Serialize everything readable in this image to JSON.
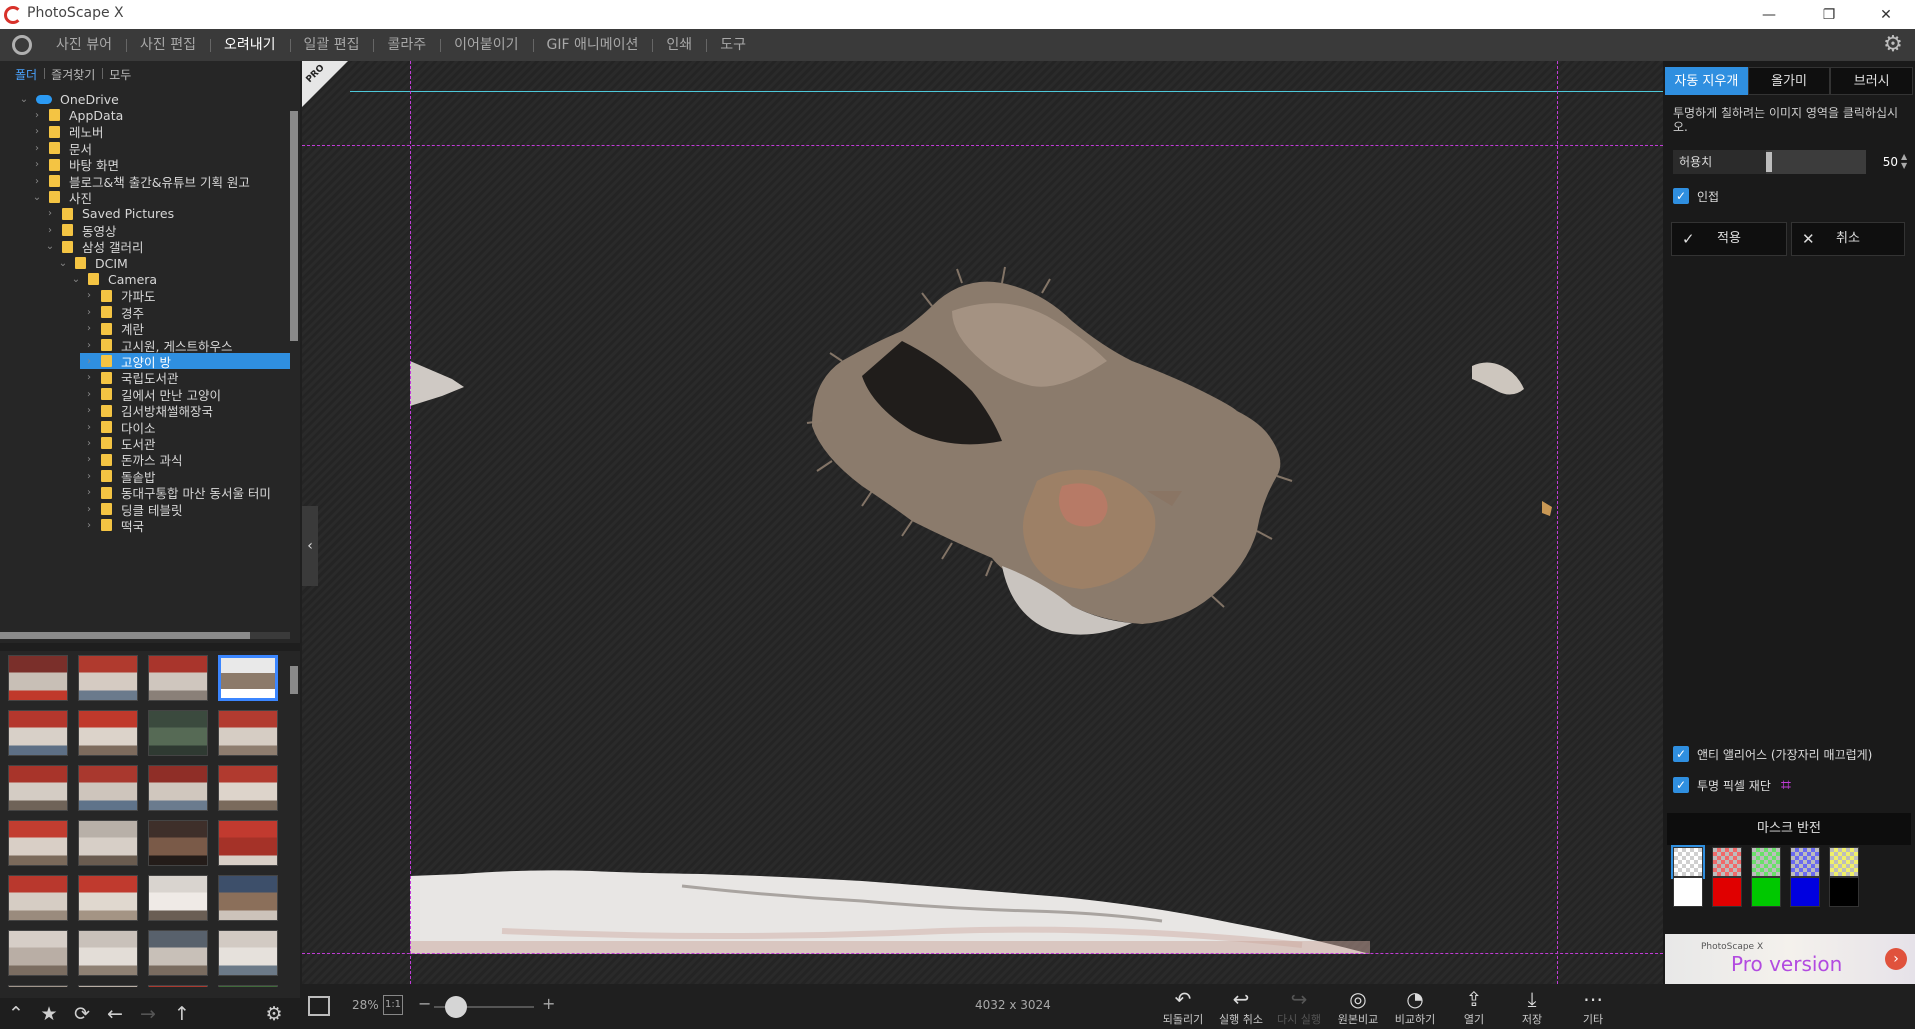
{
  "window": {
    "title": "PhotoScape X",
    "controls": [
      "—",
      "❐",
      "✕"
    ]
  },
  "menu": {
    "items": [
      {
        "label": "사진 뷰어"
      },
      {
        "label": "사진 편집"
      },
      {
        "label": "오려내기",
        "active": true
      },
      {
        "label": "일괄 편집"
      },
      {
        "label": "콜라주"
      },
      {
        "label": "이어붙이기"
      },
      {
        "label": "GIF 애니메이션"
      },
      {
        "label": "인쇄"
      },
      {
        "label": "도구"
      }
    ]
  },
  "left_panel": {
    "tabs": [
      {
        "label": "폴더",
        "active": true
      },
      {
        "label": "즐겨찾기"
      },
      {
        "label": "모두"
      }
    ],
    "tree": [
      {
        "label": "OneDrive",
        "depth": 1,
        "expanded": true,
        "icon": "cloud-icon"
      },
      {
        "label": "AppData",
        "depth": 2
      },
      {
        "label": "레노버",
        "depth": 2
      },
      {
        "label": "문서",
        "depth": 2
      },
      {
        "label": "바탕 화면",
        "depth": 2
      },
      {
        "label": "블로그&책 출간&유튜브 기획 원고",
        "depth": 2
      },
      {
        "label": "사진",
        "depth": 2,
        "expanded": true
      },
      {
        "label": "Saved Pictures",
        "depth": 3
      },
      {
        "label": "동영상",
        "depth": 3
      },
      {
        "label": "삼성 갤러리",
        "depth": 3,
        "expanded": true
      },
      {
        "label": "DCIM",
        "depth": 4,
        "expanded": true
      },
      {
        "label": "Camera",
        "depth": 5,
        "expanded": true
      },
      {
        "label": "가파도",
        "depth": 6
      },
      {
        "label": "경주",
        "depth": 6
      },
      {
        "label": "계란",
        "depth": 6
      },
      {
        "label": "고시원, 게스트하우스",
        "depth": 6
      },
      {
        "label": "고양이 방",
        "depth": 6,
        "selected": true
      },
      {
        "label": "국립도서관",
        "depth": 6
      },
      {
        "label": "길에서 만난 고양이",
        "depth": 6
      },
      {
        "label": "김서방채썰해장국",
        "depth": 6
      },
      {
        "label": "다이소",
        "depth": 6
      },
      {
        "label": "도서관",
        "depth": 6
      },
      {
        "label": "돈까스 과식",
        "depth": 6
      },
      {
        "label": "돌솥밥",
        "depth": 6
      },
      {
        "label": "동대구통합 마산 동서울 터미",
        "depth": 6
      },
      {
        "label": "딩클 테블릿",
        "depth": 6
      },
      {
        "label": "떡국",
        "depth": 6
      }
    ],
    "thumbnails": [
      {
        "colors": [
          "#7a2f2a",
          "#c8bfb6",
          "#c0392b"
        ]
      },
      {
        "colors": [
          "#b03a2e",
          "#d5cbc2",
          "#6a7a8c"
        ]
      },
      {
        "colors": [
          "#a9352c",
          "#cfc6be",
          "#8a8078"
        ]
      },
      {
        "colors": [
          "#e9e9e9",
          "#8c7a6a",
          "#ffffff"
        ],
        "selected": true
      },
      {
        "colors": [
          "#b4372d",
          "#d8d0c8",
          "#5d6f85"
        ]
      },
      {
        "colors": [
          "#c0392b",
          "#dcd3ca",
          "#7d6b5d"
        ]
      },
      {
        "colors": [
          "#3b4a3e",
          "#566a55",
          "#2f3a32"
        ]
      },
      {
        "colors": [
          "#b23b30",
          "#d6cdc4",
          "#8e7d6f"
        ]
      },
      {
        "colors": [
          "#a8342a",
          "#d4ccc4",
          "#6f6358"
        ]
      },
      {
        "colors": [
          "#a9382e",
          "#cec5bc",
          "#5f738a"
        ]
      },
      {
        "colors": [
          "#8f2e27",
          "#d0c7be",
          "#6a7b8e"
        ]
      },
      {
        "colors": [
          "#b13a2f",
          "#ddd4cb",
          "#7a6a5c"
        ]
      },
      {
        "colors": [
          "#c23d30",
          "#d9cfc6",
          "#7b6a5b"
        ]
      },
      {
        "colors": [
          "#b8b0a8",
          "#d7cfc7",
          "#6a5c50"
        ]
      },
      {
        "colors": [
          "#3e2f2a",
          "#7a5a48",
          "#241c19"
        ]
      },
      {
        "colors": [
          "#c13a2f",
          "#a53228",
          "#d8cfc6"
        ]
      },
      {
        "colors": [
          "#b9382d",
          "#d6cdc4",
          "#9a8b7d"
        ]
      },
      {
        "colors": [
          "#c03a2e",
          "#e0d8cf",
          "#a49484"
        ]
      },
      {
        "colors": [
          "#d9d4cf",
          "#efeae6",
          "#6a5e54"
        ]
      },
      {
        "colors": [
          "#3d4f6a",
          "#8b6f5a",
          "#ccc3ba"
        ]
      },
      {
        "colors": [
          "#d6cec7",
          "#b9aea5",
          "#7b6d61"
        ]
      },
      {
        "colors": [
          "#c9c1ba",
          "#e3ddd7",
          "#8f8174"
        ]
      },
      {
        "colors": [
          "#58616c",
          "#c8c0b8",
          "#7a6c60"
        ]
      },
      {
        "colors": [
          "#d2cac3",
          "#e6e1dc",
          "#6c7a88"
        ]
      },
      {
        "colors": [
          "#a0958b",
          "#c9c0b8",
          "#7d7166"
        ]
      },
      {
        "colors": [
          "#b9aea4",
          "#d8d0c9",
          "#8a7d71"
        ]
      },
      {
        "colors": [
          "#a9392f",
          "#cfc6be",
          "#5e6b7a"
        ]
      },
      {
        "colors": [
          "#3f6a3a",
          "#5b8a4f",
          "#2c4a28"
        ]
      }
    ],
    "bottom_icons": [
      "chevron-up-icon",
      "star-icon",
      "refresh-icon",
      "arrow-left-icon",
      "arrow-right-icon",
      "arrow-up-icon",
      "gear-icon"
    ]
  },
  "canvas": {
    "pro_badge": "PRO"
  },
  "statusbar": {
    "zoom": "28%",
    "actual_size": "1:1",
    "zoom_level": 0.14,
    "image_size": "4032 x 3024",
    "tools": [
      {
        "label": "되돌리기",
        "icon": "↶",
        "name": "revert-button"
      },
      {
        "label": "실행 취소",
        "icon": "↩",
        "name": "undo-button"
      },
      {
        "label": "다시 실행",
        "icon": "↪",
        "name": "redo-button",
        "disabled": true
      },
      {
        "label": "원본비교",
        "icon": "◎",
        "name": "compare-original-button"
      },
      {
        "label": "비교하기",
        "icon": "◔",
        "name": "compare-button"
      },
      {
        "label": "열기",
        "icon": "⇪",
        "name": "open-button"
      },
      {
        "label": "저장",
        "icon": "⤓",
        "name": "save-button"
      },
      {
        "label": "기타",
        "icon": "⋯",
        "name": "more-button"
      }
    ]
  },
  "right_panel": {
    "tabs": [
      {
        "label": "자동 지우개",
        "active": true
      },
      {
        "label": "올가미"
      },
      {
        "label": "브러시"
      }
    ],
    "instruction": "투명하게 칠하려는 이미지 영역을 클릭하십시오.",
    "tolerance": {
      "label": "허용치",
      "value": "50",
      "level": 0.0
    },
    "adjacent": {
      "label": "인접",
      "checked": true
    },
    "apply_label": "적용",
    "cancel_label": "취소",
    "antialias": {
      "label": "앤티 앨리어스 (가장자리 매끄럽게)",
      "checked": true
    },
    "trim": {
      "label": "투명 픽셀 재단",
      "checked": true
    },
    "mask_invert_label": "마스크 반전",
    "swatches": [
      {
        "color": "checker-white",
        "selected": true
      },
      {
        "color": "#f06a6a"
      },
      {
        "color": "#6ae06a"
      },
      {
        "color": "#6a6af0"
      },
      {
        "color": "#f0f06a"
      },
      {
        "color": "#ffffff"
      },
      {
        "color": "#e00000"
      },
      {
        "color": "#00c800"
      },
      {
        "color": "#0000e0"
      },
      {
        "color": "#000000"
      }
    ],
    "pro_banner": {
      "logo": "PhotoScape X",
      "text": "Pro version"
    }
  },
  "colors": {
    "accent": "#2f8fe0",
    "guide": "#c03bd6",
    "cyan_line": "#4ec8d8"
  }
}
